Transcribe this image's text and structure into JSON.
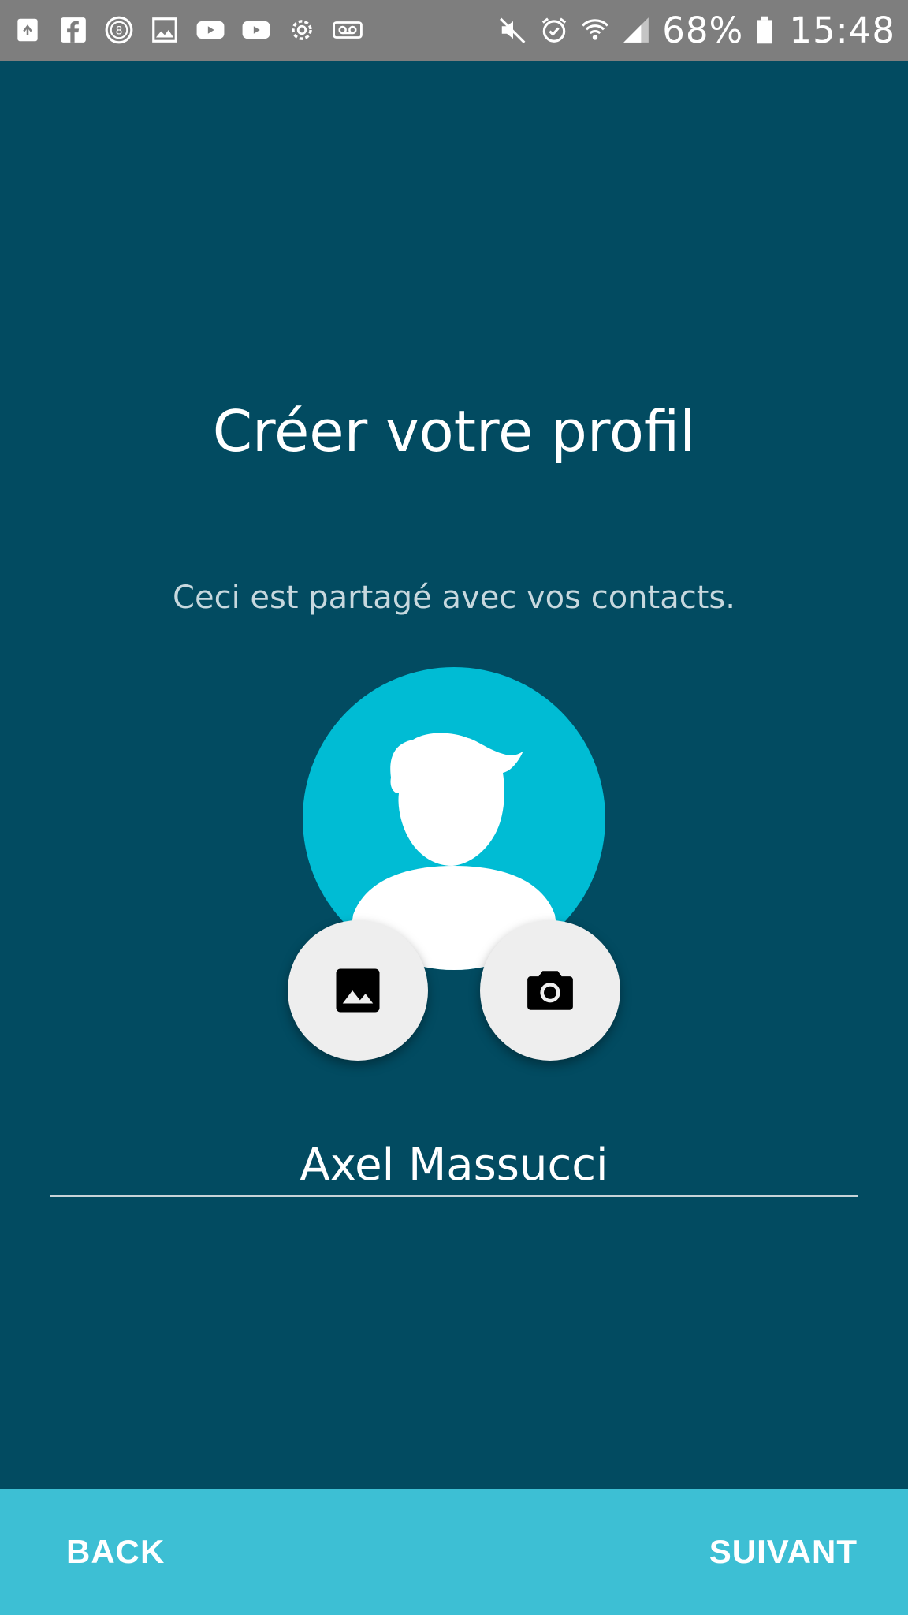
{
  "status_bar": {
    "left_icons": [
      "recycle-notification-icon",
      "facebook-icon",
      "number-8-icon",
      "image-icon",
      "youtube-icon",
      "youtube-icon",
      "settings-gear-icon",
      "voicemail-icon"
    ],
    "right_icons": [
      "mute-icon",
      "alarm-icon",
      "wifi-icon",
      "signal-icon"
    ],
    "battery_percent": "68%",
    "time": "15:48"
  },
  "page": {
    "title": "Créer votre profil",
    "subtitle": "Ceci est partagé avec vos contacts."
  },
  "avatar": {
    "icon": "user-silhouette-icon",
    "background_color": "#00bcd4"
  },
  "photo_actions": {
    "gallery_icon": "image-icon",
    "camera_icon": "camera-icon"
  },
  "name_field": {
    "value": "Axel Massucci"
  },
  "footer": {
    "back_label": "BACK",
    "next_label": "SUIVANT"
  },
  "colors": {
    "background": "#024b61",
    "status_bar": "#7e7e7e",
    "footer_bar": "#3dbfd4",
    "avatar": "#00bcd4"
  }
}
